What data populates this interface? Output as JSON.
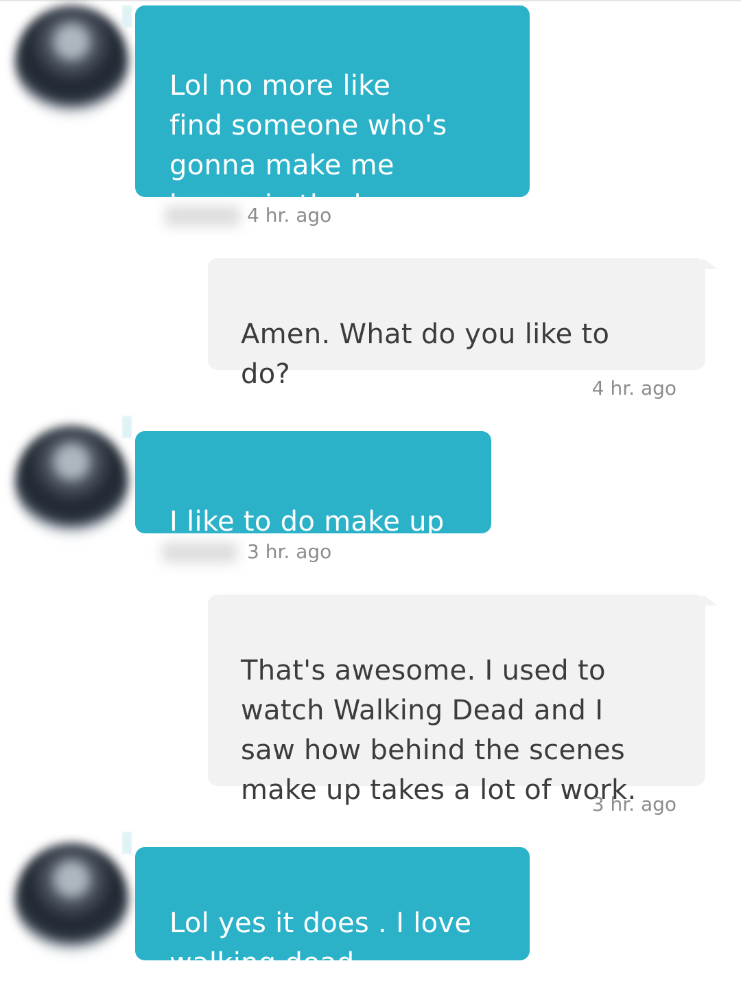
{
  "conversation": {
    "messages": [
      {
        "direction": "incoming",
        "text": "Lol no more like\nfind someone who's\ngonna make me\nhappy in the long run",
        "timestamp": "4 hr. ago"
      },
      {
        "direction": "outgoing",
        "text": "Amen. What do you like to\ndo?",
        "timestamp": "4 hr. ago"
      },
      {
        "direction": "incoming",
        "text": "I like to do make up",
        "timestamp": "3 hr. ago"
      },
      {
        "direction": "outgoing",
        "text": "That's awesome. I used to\nwatch Walking Dead and I\nsaw how behind the scenes\nmake up takes a lot of work.",
        "timestamp": "3 hr. ago"
      },
      {
        "direction": "incoming",
        "text": "Lol yes it does . I love\nwalking dead",
        "timestamp": ""
      }
    ]
  },
  "colors": {
    "incoming_bubble": "#2bb2c9",
    "outgoing_bubble": "#f2f2f2",
    "timestamp_text": "#8c8c8c"
  }
}
